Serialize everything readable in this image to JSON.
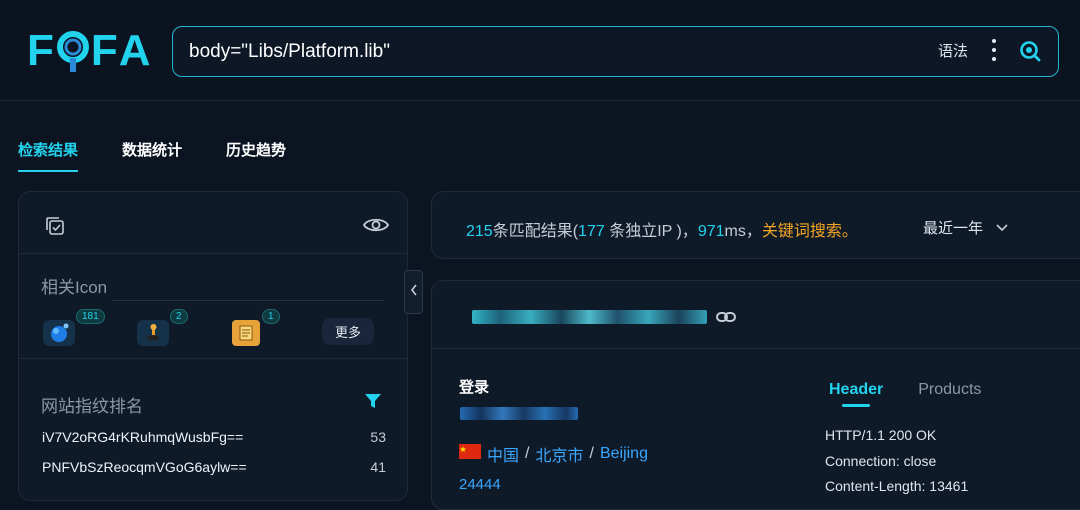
{
  "app": {
    "logo_letters": [
      "F",
      "F",
      "A"
    ],
    "accent_color": "#22d3ee"
  },
  "search": {
    "query": "body=\"Libs/Platform.lib\"",
    "syntax_label": "语法",
    "more_icon": "more-vertical-icon",
    "search_icon": "search-icon"
  },
  "tabs": [
    {
      "label": "检索结果",
      "active": true
    },
    {
      "label": "数据统计",
      "active": false
    },
    {
      "label": "历史趋势",
      "active": false
    }
  ],
  "left_panel": {
    "related_icon_title": "相关Icon",
    "icons": [
      {
        "name": "globe-favicon-icon",
        "count": "181"
      },
      {
        "name": "joystick-favicon-icon",
        "count": "2"
      },
      {
        "name": "document-favicon-icon",
        "count": "1"
      }
    ],
    "more_label": "更多",
    "fingerprint_title": "网站指纹排名",
    "fingerprints": [
      {
        "hash": "iV7V2oRG4rKRuhmqWusbFg==",
        "count": "53"
      },
      {
        "hash": "PNFVbSzReocqmVGoG6aylw==",
        "count": "41"
      }
    ]
  },
  "summary": {
    "total": "215",
    "total_suffix": "条匹配结果(",
    "unique_ip": "177",
    "ip_suffix": " 条独立IP )，",
    "time": "971",
    "time_suffix": "ms，",
    "keyword_search": "关键词搜索。",
    "range_label": "最近一年"
  },
  "result": {
    "title": "登录",
    "country": "中国",
    "city": "北京市",
    "city_en": "Beijing",
    "port": "24444",
    "tabs": [
      "Header",
      "Products"
    ],
    "header_lines": [
      "HTTP/1.1 200 OK",
      "Connection: close",
      "Content-Length: 13461"
    ]
  }
}
